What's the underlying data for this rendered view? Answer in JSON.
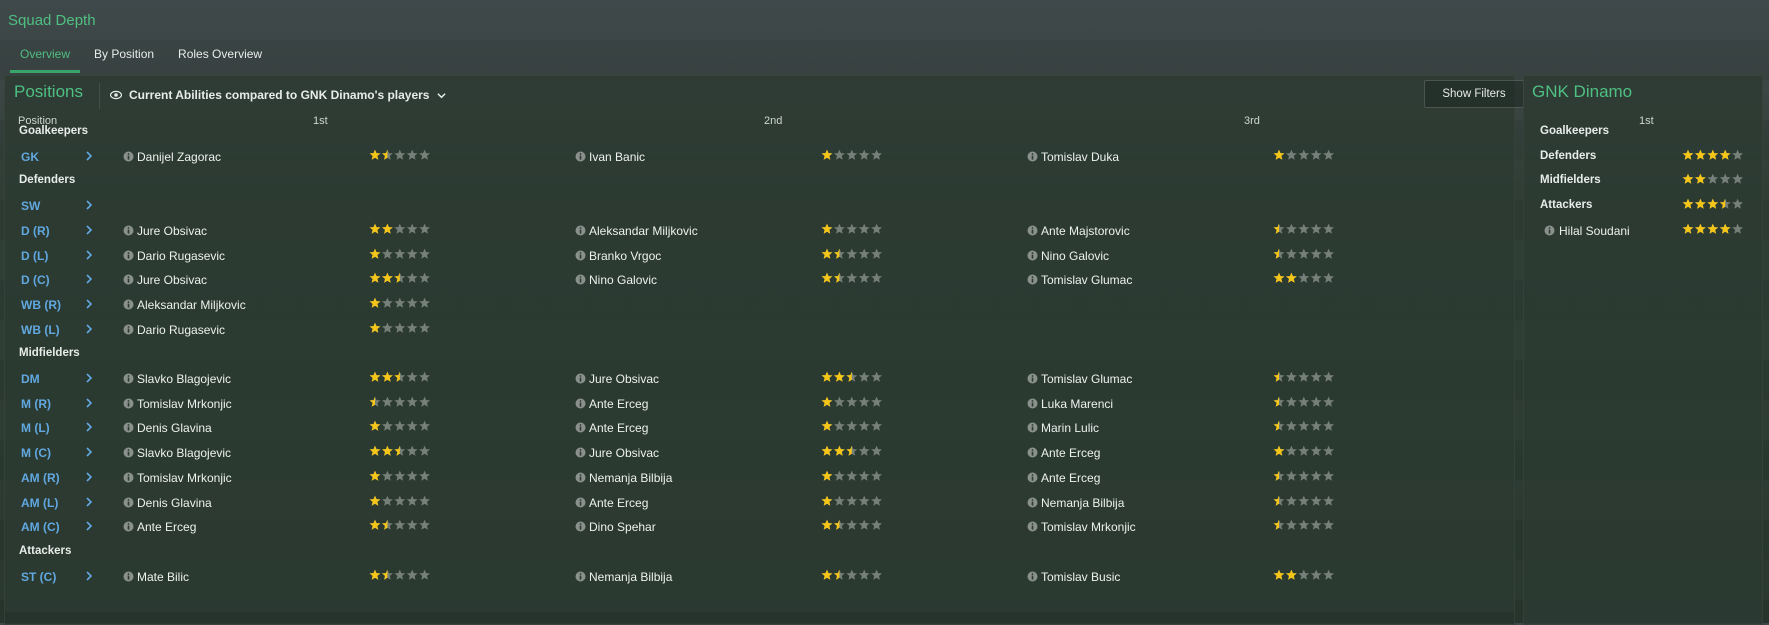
{
  "page": {
    "title": "Squad Depth"
  },
  "tabs": [
    {
      "label": "Overview",
      "active": true
    },
    {
      "label": "By Position",
      "active": false
    },
    {
      "label": "Roles Overview",
      "active": false
    }
  ],
  "main": {
    "title": "Positions",
    "compare_label": "Current Abilities compared to GNK Dinamo's players",
    "show_filters": "Show Filters",
    "headers": {
      "position": "Position",
      "first": "1st",
      "second": "2nd",
      "third": "3rd"
    },
    "rows": [
      {
        "type": "section",
        "label": "Goalkeepers"
      },
      {
        "type": "pos",
        "pos": "GK",
        "players": [
          {
            "name": "Danijel Zagorac",
            "stars": 1.5
          },
          {
            "name": "Ivan Banic",
            "stars": 1.0
          },
          {
            "name": "Tomislav Duka",
            "stars": 1.0
          }
        ]
      },
      {
        "type": "section",
        "label": "Defenders"
      },
      {
        "type": "pos",
        "pos": "SW",
        "players": []
      },
      {
        "type": "pos",
        "pos": "D (R)",
        "players": [
          {
            "name": "Jure Obsivac",
            "stars": 2.0
          },
          {
            "name": "Aleksandar Miljkovic",
            "stars": 1.0
          },
          {
            "name": "Ante Majstorovic",
            "stars": 0.5
          }
        ]
      },
      {
        "type": "pos",
        "pos": "D (L)",
        "players": [
          {
            "name": "Dario Rugasevic",
            "stars": 1.0
          },
          {
            "name": "Branko Vrgoc",
            "stars": 1.5
          },
          {
            "name": "Nino Galovic",
            "stars": 0.5
          }
        ]
      },
      {
        "type": "pos",
        "pos": "D (C)",
        "players": [
          {
            "name": "Jure Obsivac",
            "stars": 2.5
          },
          {
            "name": "Nino Galovic",
            "stars": 1.5
          },
          {
            "name": "Tomislav Glumac",
            "stars": 2.0
          }
        ]
      },
      {
        "type": "pos",
        "pos": "WB (R)",
        "players": [
          {
            "name": "Aleksandar Miljkovic",
            "stars": 1.0
          }
        ]
      },
      {
        "type": "pos",
        "pos": "WB (L)",
        "players": [
          {
            "name": "Dario Rugasevic",
            "stars": 1.0
          }
        ]
      },
      {
        "type": "section",
        "label": "Midfielders"
      },
      {
        "type": "pos",
        "pos": "DM",
        "players": [
          {
            "name": "Slavko Blagojevic",
            "stars": 2.5
          },
          {
            "name": "Jure Obsivac",
            "stars": 2.5
          },
          {
            "name": "Tomislav Glumac",
            "stars": 0.5
          }
        ]
      },
      {
        "type": "pos",
        "pos": "M (R)",
        "players": [
          {
            "name": "Tomislav Mrkonjic",
            "stars": 0.5
          },
          {
            "name": "Ante Erceg",
            "stars": 1.0
          },
          {
            "name": "Luka Marenci",
            "stars": 0.5
          }
        ]
      },
      {
        "type": "pos",
        "pos": "M (L)",
        "players": [
          {
            "name": "Denis Glavina",
            "stars": 1.0
          },
          {
            "name": "Ante Erceg",
            "stars": 1.0
          },
          {
            "name": "Marin Lulic",
            "stars": 0.5
          }
        ]
      },
      {
        "type": "pos",
        "pos": "M (C)",
        "players": [
          {
            "name": "Slavko Blagojevic",
            "stars": 2.5
          },
          {
            "name": "Jure Obsivac",
            "stars": 2.5
          },
          {
            "name": "Ante Erceg",
            "stars": 1.0
          }
        ]
      },
      {
        "type": "pos",
        "pos": "AM (R)",
        "players": [
          {
            "name": "Tomislav Mrkonjic",
            "stars": 1.0
          },
          {
            "name": "Nemanja Bilbija",
            "stars": 1.0
          },
          {
            "name": "Ante Erceg",
            "stars": 0.5
          }
        ]
      },
      {
        "type": "pos",
        "pos": "AM (L)",
        "players": [
          {
            "name": "Denis Glavina",
            "stars": 1.0
          },
          {
            "name": "Ante Erceg",
            "stars": 1.0
          },
          {
            "name": "Nemanja Bilbija",
            "stars": 0.5
          }
        ]
      },
      {
        "type": "pos",
        "pos": "AM (C)",
        "players": [
          {
            "name": "Ante Erceg",
            "stars": 1.5
          },
          {
            "name": "Dino Spehar",
            "stars": 1.5
          },
          {
            "name": "Tomislav Mrkonjic",
            "stars": 0.5
          }
        ]
      },
      {
        "type": "section",
        "label": "Attackers"
      },
      {
        "type": "pos",
        "pos": "ST (C)",
        "players": [
          {
            "name": "Mate Bilic",
            "stars": 1.5
          },
          {
            "name": "Nemanja Bilbija",
            "stars": 1.5
          },
          {
            "name": "Tomislav Busic",
            "stars": 2.0
          }
        ]
      }
    ]
  },
  "side": {
    "title": "GNK Dinamo",
    "header": "1st",
    "rows": [
      {
        "type": "section",
        "label": "Goalkeepers",
        "stars": null
      },
      {
        "type": "section",
        "label": "Defenders",
        "stars": 4.0
      },
      {
        "type": "section",
        "label": "Midfielders",
        "stars": 2.0
      },
      {
        "type": "section",
        "label": "Attackers",
        "stars": 3.5
      },
      {
        "type": "player",
        "label": "Hilal Soudani",
        "stars": 4.0
      }
    ]
  },
  "colors": {
    "accent": "#4fbf82",
    "position": "#61a8e0",
    "star": "#f5c518",
    "star_empty": "#777f7a"
  }
}
